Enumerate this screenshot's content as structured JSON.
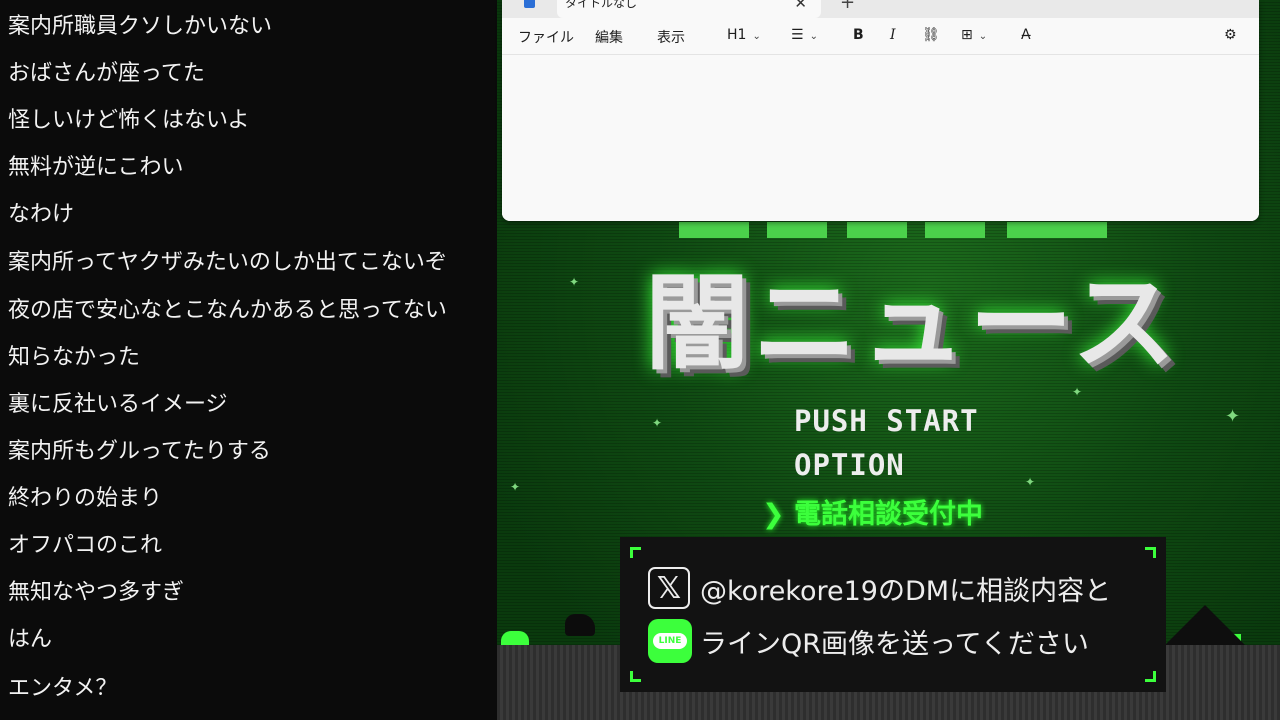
{
  "comments": [
    "案内所職員クソしかいない",
    "おばさんが座ってた",
    "怪しいけど怖くはないよ",
    "無料が逆にこわい",
    "なわけ",
    "案内所ってヤクザみたいのしか出てこないぞ",
    "夜の店で安心なとこなんかあると思ってない",
    "知らなかった",
    "裏に反社いるイメージ",
    "案内所もグルってたりする",
    "終わりの始まり",
    "オフパコのこれ",
    "無知なやつ多すぎ",
    "はん",
    "エンタメ？"
  ],
  "notepad": {
    "tab_title": "タイトルなし",
    "close_glyph": "✕",
    "new_tab_glyph": "+",
    "menu": {
      "file": "ファイル",
      "edit": "編集",
      "view": "表示"
    },
    "heading_label": "H1",
    "bold_label": "B",
    "italic_label": "I",
    "editor_text": ""
  },
  "game": {
    "title": "闇ニュース",
    "menu_items": [
      "PUSH START",
      "OPTION"
    ],
    "selected_item": "電話相談受付中",
    "selector_glyph": "❯",
    "info_line1": "@korekore19のDMに相談内容と",
    "info_line2": "ラインQR画像を送ってください",
    "x_icon_label": "𝕏",
    "line_icon_label": "LINE"
  },
  "colors": {
    "accent": "#3cff3c",
    "panel": "#121212",
    "window": "#f9f9f9"
  }
}
